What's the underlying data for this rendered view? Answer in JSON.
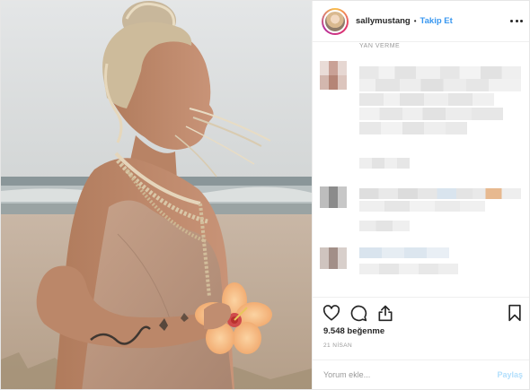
{
  "header": {
    "username": "sallymustang",
    "separator": "•",
    "follow_label": "Takip Et"
  },
  "comments": {
    "cut_text": "YAN    VERME"
  },
  "actions": {
    "likes_text": "9.548 beğenme",
    "date_text": "21 NİSAN"
  },
  "comment_bar": {
    "placeholder": "Yorum ekle...",
    "share_label": "Paylaş"
  },
  "colors": {
    "accent": "#3897f0",
    "share_disabled": "#b2dffc",
    "text": "#262626",
    "muted": "#999999",
    "border": "#efefef"
  },
  "icons": [
    "more-options-icon",
    "heart-icon",
    "comment-icon",
    "share-icon",
    "bookmark-icon"
  ]
}
